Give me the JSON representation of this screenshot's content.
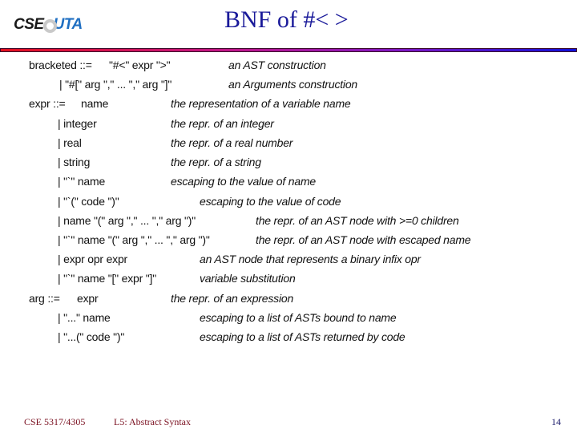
{
  "header": {
    "logo": {
      "left": "CSE",
      "right": "UTA",
      "icon": "ring-logo-icon"
    },
    "title": "BNF of #< >",
    "rule_colors": [
      "#e3101e",
      "#c0158a",
      "#7c16c4",
      "#1010d8"
    ]
  },
  "grammar": [
    {
      "lhs": "bracketed ::=",
      "rhs": "\"#<\" expr \">\"",
      "desc": "an AST construction"
    },
    {
      "lhs": "",
      "rhs": "| \"#[\" arg \",\" ... \",\" arg \"]\"",
      "desc": "an Arguments construction"
    },
    {
      "lhs": "expr ::=",
      "rhs": "name",
      "desc": "the representation of a variable name"
    },
    {
      "lhs": "",
      "rhs": "| integer",
      "desc": "the repr. of an integer"
    },
    {
      "lhs": "",
      "rhs": "| real",
      "desc": "the repr. of a real number"
    },
    {
      "lhs": "",
      "rhs": "| string",
      "desc": "the repr. of a string"
    },
    {
      "lhs": "",
      "rhs": "| \"`\" name",
      "desc": "escaping to the value of name"
    },
    {
      "lhs": "",
      "rhs": "| \"`(\" code \")\"",
      "desc": "escaping to the value of code"
    },
    {
      "lhs": "",
      "rhs": "| name \"(\" arg \",\" ... \",\" arg \")\"",
      "desc": "the repr. of an AST node with >=0 children"
    },
    {
      "lhs": "",
      "rhs": "| \"`\" name \"(\" arg \",\" ... \",\" arg \")\"",
      "desc": "the repr. of an AST node with escaped name"
    },
    {
      "lhs": "",
      "rhs": "| expr opr expr",
      "desc": "an AST node that represents a binary infix opr"
    },
    {
      "lhs": "",
      "rhs": "| \"`\" name \"[\" expr \"]\"",
      "desc": "variable substitution"
    },
    {
      "lhs": "arg ::=",
      "rhs": "expr",
      "desc": "the repr. of an expression"
    },
    {
      "lhs": "",
      "rhs": "| \"...\" name",
      "desc": "escaping to a list of ASTs bound to name"
    },
    {
      "lhs": "",
      "rhs": "| \"...(\" code \")\"",
      "desc": "escaping to a list of ASTs returned by code"
    }
  ],
  "footer": {
    "course": "CSE 5317/4305",
    "lecture": "L5: Abstract Syntax",
    "page": "14"
  }
}
